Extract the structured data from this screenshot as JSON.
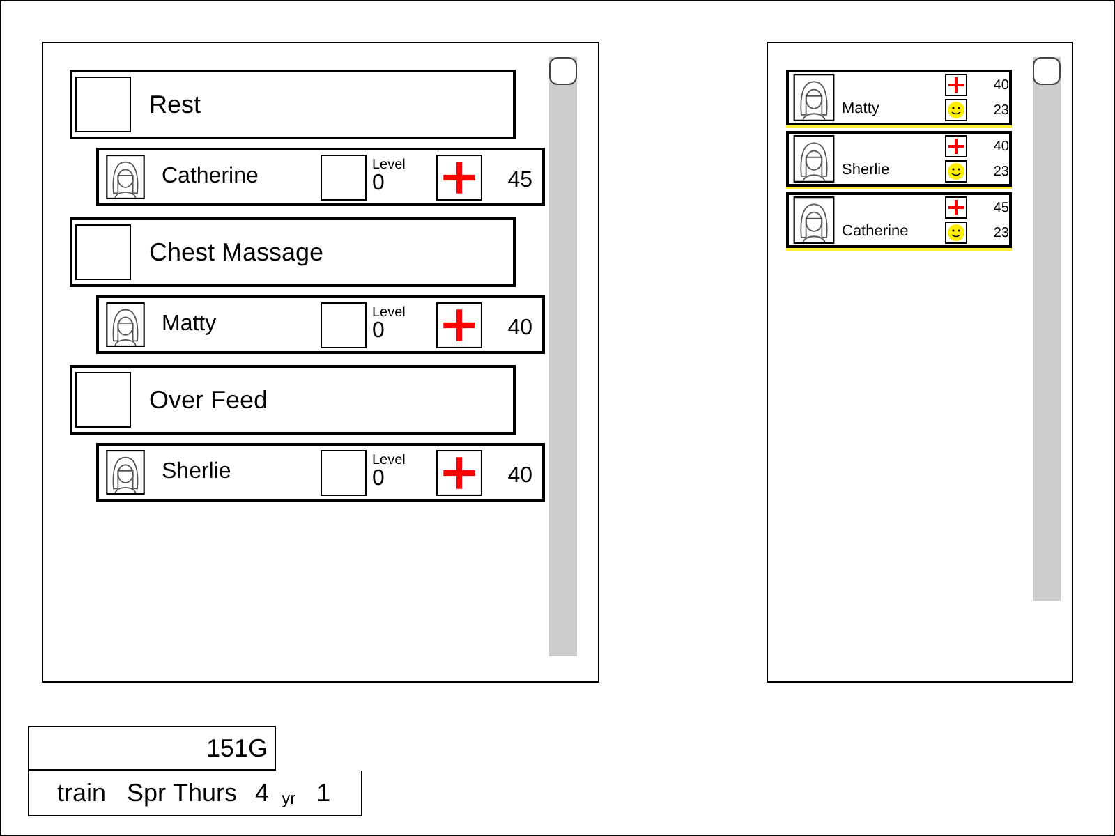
{
  "tasks": [
    {
      "name": "Rest",
      "assignee": {
        "name": "Catherine",
        "level_label": "Level",
        "level_reading": "0",
        "health": "45"
      }
    },
    {
      "name": "Chest Massage",
      "assignee": {
        "name": "Matty",
        "level_label": "Level",
        "level_reading": "0",
        "health": "40"
      }
    },
    {
      "name": "Over Feed",
      "assignee": {
        "name": "Sherlie",
        "level_label": "Level",
        "level_reading": "0",
        "health": "40"
      }
    }
  ],
  "roster": [
    {
      "name": "Matty",
      "health": "40",
      "mood": "23"
    },
    {
      "name": "Sherlie",
      "health": "40",
      "mood": "23"
    },
    {
      "name": "Catherine",
      "health": "45",
      "mood": "23"
    }
  ],
  "gold": "151G",
  "status": {
    "mode": "train",
    "season": "Spr",
    "day": "Thurs",
    "week": "4",
    "year_label": "yr",
    "year": "1"
  }
}
